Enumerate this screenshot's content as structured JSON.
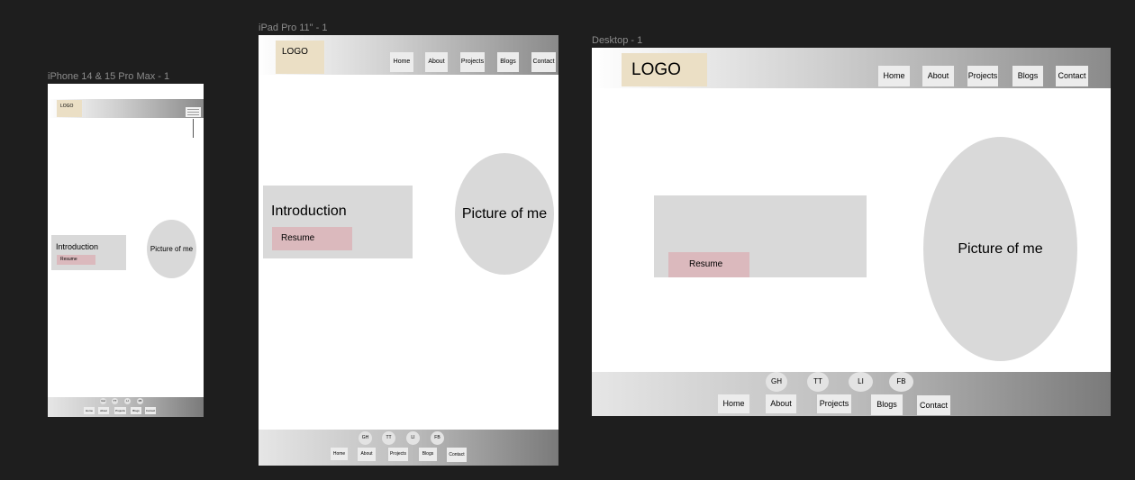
{
  "frames": {
    "iphone": {
      "label": "iPhone 14 & 15 Pro Max - 1",
      "logo": "LOGO",
      "intro": "Introduction",
      "resume": "Resume",
      "picture": "Picture of me",
      "social": [
        "GH",
        "TT",
        "LI",
        "FB"
      ],
      "nav": [
        "Home",
        "About",
        "Projects",
        "Blogs",
        "Contact"
      ]
    },
    "ipad": {
      "label": "iPad Pro 11\" - 1",
      "logo": "LOGO",
      "nav": [
        "Home",
        "About",
        "Projects",
        "Blogs",
        "Contact"
      ],
      "intro": "Introduction",
      "resume": "Resume",
      "picture": "Picture of me",
      "social": [
        "GH",
        "TT",
        "LI",
        "FB"
      ],
      "footer_nav": [
        "Home",
        "About",
        "Projects",
        "Blogs",
        "Contact"
      ]
    },
    "desktop": {
      "label": "Desktop - 1",
      "logo": "LOGO",
      "nav": [
        "Home",
        "About",
        "Projects",
        "Blogs",
        "Contact"
      ],
      "resume": "Resume",
      "picture": "Picture of me",
      "social": [
        "GH",
        "TT",
        "LI",
        "FB"
      ],
      "footer_nav": [
        "Home",
        "About",
        "Projects",
        "Blogs",
        "Contact"
      ]
    }
  },
  "colors": {
    "canvas": "#1e1e1e",
    "frame": "#ffffff",
    "logo_bg": "#ebdfc5",
    "resume_bg": "#dbb9bd",
    "placeholder": "#d9d9d9"
  }
}
